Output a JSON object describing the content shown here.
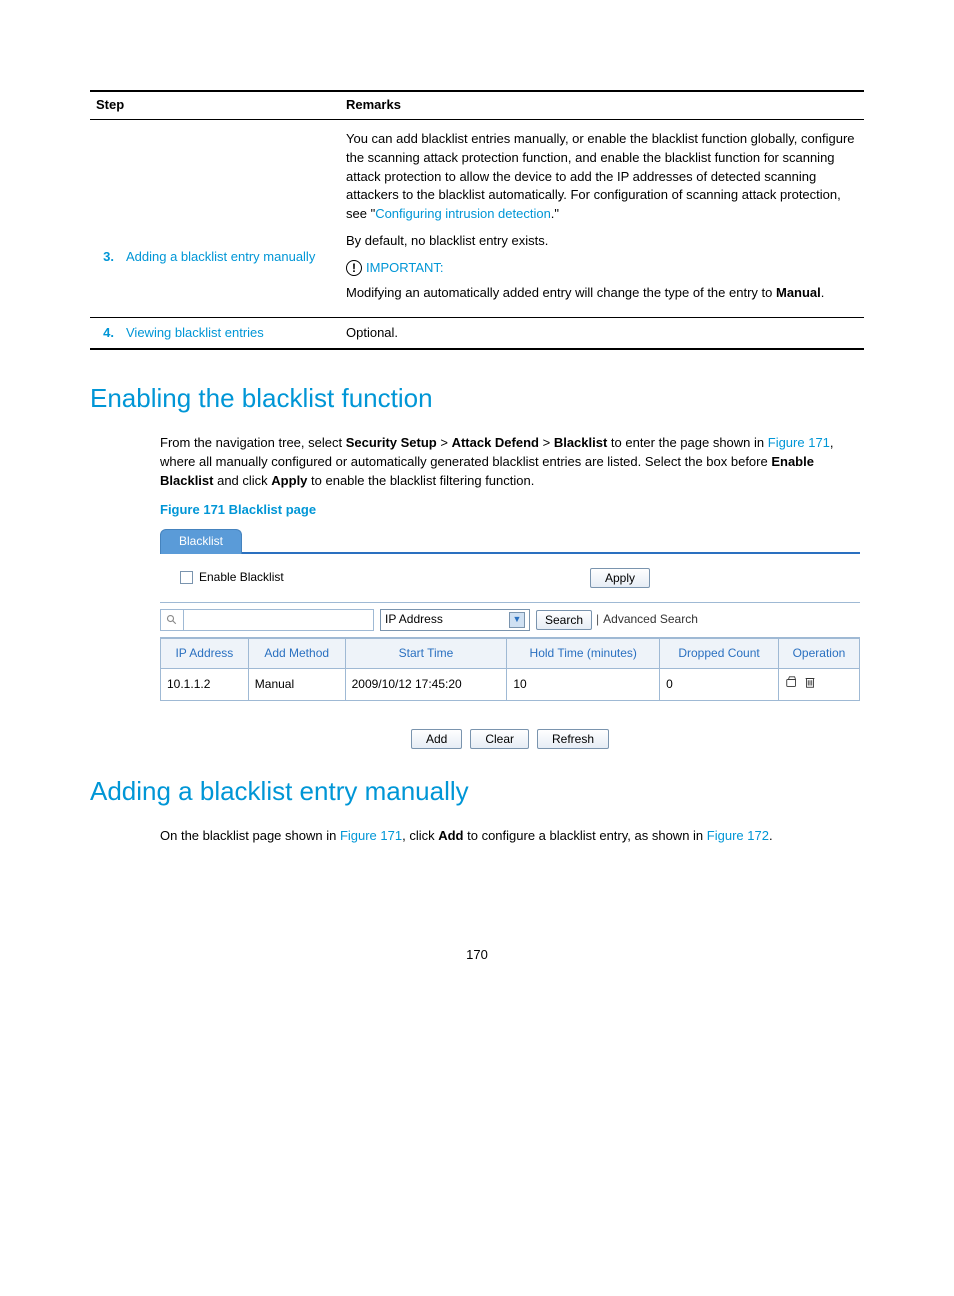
{
  "steps": {
    "headers": {
      "step": "Step",
      "remarks": "Remarks"
    },
    "row3": {
      "num": "3.",
      "name": "Adding a blacklist entry manually",
      "p1a": "You can add blacklist entries manually, or enable the blacklist function globally, configure the scanning attack protection function, and enable the blacklist function for scanning attack protection to allow the device to add the IP addresses of detected scanning attackers to the blacklist automatically. For configuration of scanning attack protection, see \"",
      "p1link": "Configuring intrusion detection",
      "p1b": ".\"",
      "p2": "By default, no blacklist entry exists.",
      "imp_label": "IMPORTANT:",
      "p3a": "Modifying an automatically added entry will change the type of the entry to ",
      "p3b": "Manual",
      "p3c": "."
    },
    "row4": {
      "num": "4.",
      "name": "Viewing blacklist entries",
      "remarks": "Optional."
    }
  },
  "section1": {
    "heading": "Enabling the blacklist function",
    "para_a": "From the navigation tree, select ",
    "b1": "Security Setup",
    "gt1": " > ",
    "b2": "Attack Defend",
    "gt2": " > ",
    "b3": "Blacklist",
    "para_b": " to enter the page shown in ",
    "link1": "Figure 171",
    "para_c": ", where all manually configured or automatically generated blacklist entries are listed. Select the box before ",
    "b4": "Enable Blacklist",
    "para_d": " and click ",
    "b5": "Apply",
    "para_e": " to enable the blacklist filtering function."
  },
  "figure_caption": "Figure 171 Blacklist page",
  "fig": {
    "tab": "Blacklist",
    "enable_label": "Enable Blacklist",
    "apply": "Apply",
    "select_value": "IP Address",
    "search": "Search",
    "adv_search": "Advanced Search",
    "headers": {
      "ip": "IP Address",
      "method": "Add Method",
      "start": "Start Time",
      "hold": "Hold Time (minutes)",
      "dropped": "Dropped Count",
      "op": "Operation"
    },
    "row": {
      "ip": "10.1.1.2",
      "method": "Manual",
      "start": "2009/10/12 17:45:20",
      "hold": "10",
      "dropped": "0"
    },
    "btn_add": "Add",
    "btn_clear": "Clear",
    "btn_refresh": "Refresh"
  },
  "section2": {
    "heading": "Adding a blacklist entry manually",
    "para_a": "On the blacklist page shown in ",
    "link1": "Figure 171",
    "para_b": ", click ",
    "b1": "Add",
    "para_c": " to configure a blacklist entry, as shown in ",
    "link2": "Figure 172",
    "para_d": "."
  },
  "page_number": "170"
}
